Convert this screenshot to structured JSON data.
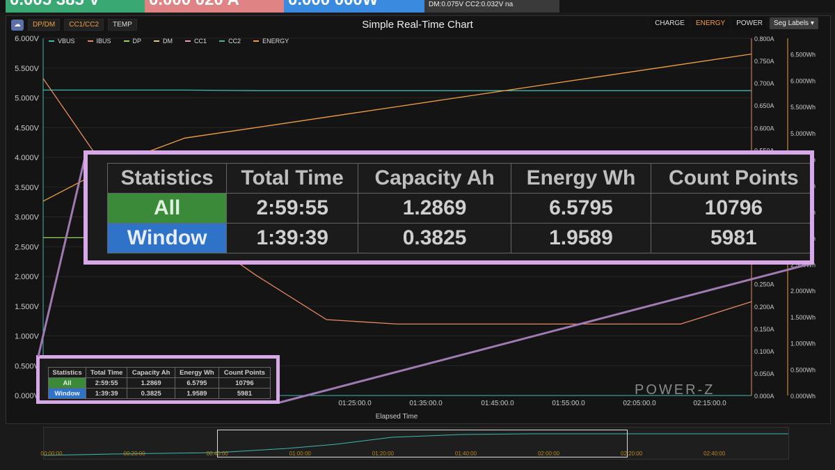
{
  "readouts": {
    "voltage": "0.005 385 V",
    "current": "0.000 020 A",
    "power": "0.000 000W",
    "dm_cc2": "DM:0.075V  CC2:0.032V  na"
  },
  "toolbar": {
    "icon": "☁",
    "btn1": "DP/DM",
    "btn2": "CC1/CC2",
    "btn3": "TEMP",
    "title": "Simple Real-Time Chart",
    "right": [
      "CHARGE",
      "ENERGY",
      "POWER"
    ],
    "select": "Seg Labels ▾"
  },
  "legend": [
    {
      "name": "VBUS",
      "color": "#3fb8b0"
    },
    {
      "name": "IBUS",
      "color": "#e98a63"
    },
    {
      "name": "DP",
      "color": "#9bd35a"
    },
    {
      "name": "DM",
      "color": "#e6c27d"
    },
    {
      "name": "CC1",
      "color": "#f0a0b0"
    },
    {
      "name": "CC2",
      "color": "#4fb0a0"
    },
    {
      "name": "ENERGY",
      "color": "#f2a040"
    }
  ],
  "chart_data": {
    "type": "line",
    "title": "Simple Real-Time Chart",
    "xlabel": "Elapsed Time",
    "x_ticks": [
      "01:25:00.0",
      "01:35:00.0",
      "01:45:00.0",
      "01:55:00.0",
      "02:05:00.0",
      "02:15:00.0"
    ],
    "y_left_ticks": [
      "6.000V",
      "5.500V",
      "5.000V",
      "4.500V",
      "4.000V",
      "3.500V",
      "3.000V",
      "2.500V",
      "2.000V",
      "1.500V",
      "1.000V",
      "0.500V",
      "0.000V"
    ],
    "y_right1_ticks": [
      "0.800A",
      "0.750A",
      "0.700A",
      "0.650A",
      "0.600A",
      "0.550A",
      "0.500A",
      "0.450A",
      "0.400A",
      "0.350A",
      "0.300A",
      "0.250A",
      "0.200A",
      "0.150A",
      "0.100A",
      "0.050A",
      "0.000A"
    ],
    "y_right2_ticks": [
      "6.500Wh",
      "6.000Wh",
      "5.500Wh",
      "5.000Wh",
      "4.500Wh",
      "4.000Wh",
      "3.500Wh",
      "3.000Wh",
      "2.500Wh",
      "2.000Wh",
      "1.500Wh",
      "1.000Wh",
      "0.500Wh",
      "0.000Wh"
    ],
    "ylim_left": [
      0,
      6
    ],
    "series": [
      {
        "name": "VBUS",
        "color": "#3fb8b0",
        "axis": "left",
        "values": [
          5.13,
          5.13,
          5.13,
          5.12,
          5.12,
          5.12,
          5.12,
          5.12,
          5.12,
          5.12,
          5.12
        ]
      },
      {
        "name": "ENERGY",
        "color": "#f2a040",
        "axis": "right2",
        "values": [
          3.7,
          4.4,
          4.9,
          5.1,
          5.3,
          5.5,
          5.7,
          5.9,
          6.1,
          6.3,
          6.5
        ]
      },
      {
        "name": "IBUS",
        "color": "#e98a63",
        "axis": "right1",
        "values": [
          0.71,
          0.48,
          0.38,
          0.27,
          0.17,
          0.16,
          0.16,
          0.16,
          0.16,
          0.16,
          0.21
        ]
      },
      {
        "name": "DP",
        "color": "#9bd35a",
        "axis": "left",
        "values": [
          2.65,
          2.65,
          2.65,
          2.65,
          2.65,
          2.65,
          2.65,
          2.65,
          2.65,
          2.65,
          2.65
        ]
      }
    ]
  },
  "stats": {
    "headers": [
      "Statistics",
      "Total Time",
      "Capacity Ah",
      "Energy Wh",
      "Count Points"
    ],
    "rows": [
      [
        "All",
        "2:59:55",
        "1.2869",
        "6.5795",
        "10796"
      ],
      [
        "Window",
        "1:39:39",
        "0.3825",
        "1.9589",
        "5981"
      ]
    ]
  },
  "watermark": "POWER-Z",
  "slider_ticks": [
    "00:00:00",
    "00:20:00",
    "00:40:00",
    "01:00:00",
    "01:20:00",
    "01:40:00",
    "02:00:00",
    "02:20:00",
    "02:40:00"
  ]
}
